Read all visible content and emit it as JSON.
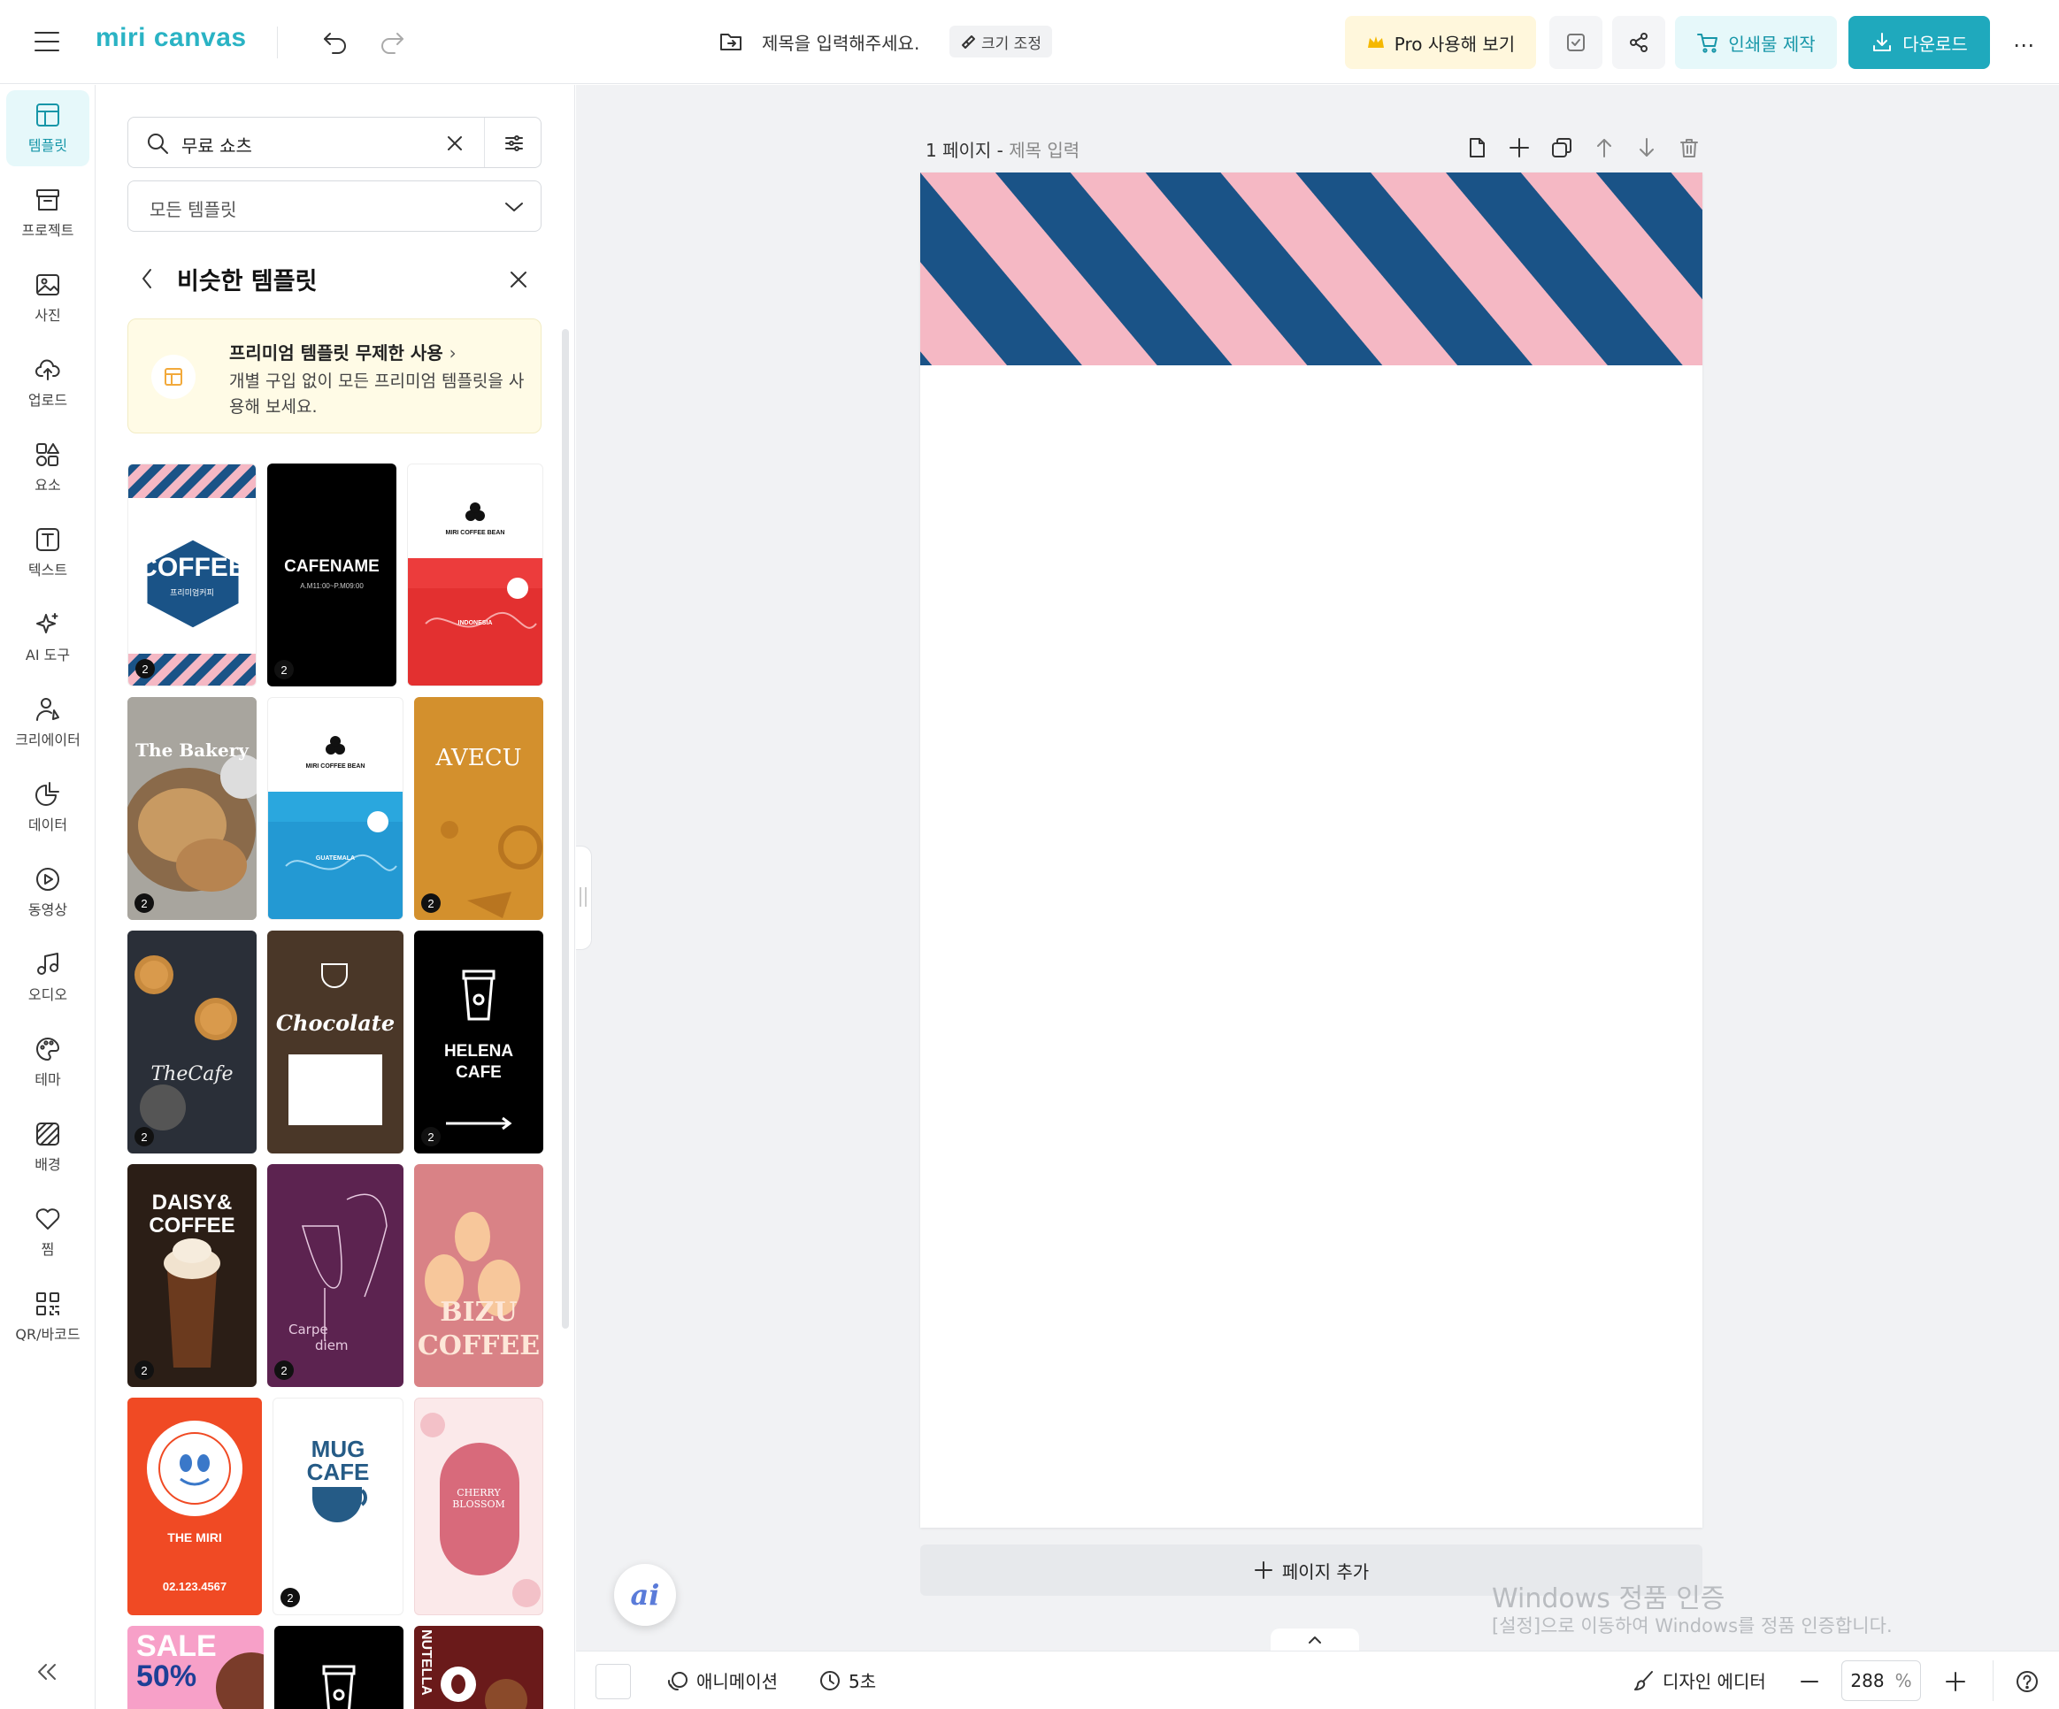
{
  "app": {
    "logo_text": "miri canvas",
    "doc_title_placeholder": "제목을 입력해주세요.",
    "resize_label": "크기 조정",
    "pro_label": "Pro 사용해 보기",
    "print_label": "인쇄물 제작",
    "download_label": "다운로드"
  },
  "nav": {
    "items": [
      {
        "label": "템플릿",
        "icon": "template-icon"
      },
      {
        "label": "프로젝트",
        "icon": "project-icon"
      },
      {
        "label": "사진",
        "icon": "photo-icon"
      },
      {
        "label": "업로드",
        "icon": "upload-icon"
      },
      {
        "label": "요소",
        "icon": "elements-icon"
      },
      {
        "label": "텍스트",
        "icon": "text-icon"
      },
      {
        "label": "AI 도구",
        "icon": "ai-tools-icon"
      },
      {
        "label": "크리에이터",
        "icon": "creator-icon"
      },
      {
        "label": "데이터",
        "icon": "data-icon"
      },
      {
        "label": "동영상",
        "icon": "video-icon"
      },
      {
        "label": "오디오",
        "icon": "audio-icon"
      },
      {
        "label": "테마",
        "icon": "theme-icon"
      },
      {
        "label": "배경",
        "icon": "background-icon"
      },
      {
        "label": "찜",
        "icon": "heart-icon"
      },
      {
        "label": "QR/바코드",
        "icon": "qr-icon"
      }
    ]
  },
  "panel": {
    "search_value": "무료 쇼츠",
    "category_selected": "모든 템플릿",
    "similar_title": "비슷한 템플릿",
    "promo_title": "프리미엄 템플릿 무제한 사용",
    "promo_desc": "개별 구입 없이 모든 프리미엄 템플릿을 사용해 보세요.",
    "templates": {
      "coffee": {
        "title": "COFFEE",
        "sub": "프리미엄커피",
        "badge": "2"
      },
      "cafename": {
        "title": "CAFENAME",
        "sub": "A.M11:00~P.M09:00",
        "badge": "2"
      },
      "bean_red": {
        "title": "MIRI COFFEE BEAN",
        "country": "INDONESIA"
      },
      "bakery": {
        "title": "The Bakery",
        "badge": "2"
      },
      "bean_blue": {
        "title": "MIRI COFFEE BEAN",
        "country": "GUATEMALA"
      },
      "avecu": {
        "title": "AVECU",
        "badge": "2"
      },
      "thecafe": {
        "title": "TheCafe",
        "badge": "2"
      },
      "chocolate": {
        "title": "Chocolate"
      },
      "helena": {
        "title1": "HELENA",
        "title2": "CAFE",
        "badge": "2"
      },
      "daisy": {
        "title1": "DAISY&",
        "title2": "COFFEE",
        "badge": "2"
      },
      "carpe": {
        "title1": "Carpe",
        "title2": "diem",
        "badge": "2"
      },
      "bizu": {
        "title1": "BIZU",
        "title2": "COFFEE"
      },
      "smoothie": {
        "title": "THE MIRI",
        "phone": "02.123.4567"
      },
      "mugcafe": {
        "title1": "MUG",
        "title2": "CAFE",
        "badge": "2"
      },
      "cherry": {
        "title": "CHERRY BLOSSOM"
      },
      "sale": {
        "title1": "SALE",
        "title2": "50%"
      },
      "nutella": {
        "title": "NUTELLA"
      }
    }
  },
  "workspace": {
    "page_number": "1 페이지",
    "separator": " - ",
    "page_title_placeholder": "제목 입력",
    "add_page_label": "페이지 추가",
    "watermark_title": "Windows 정품 인증",
    "watermark_desc": "[설정]으로 이동하여 Windows를 정품 인증합니다."
  },
  "bottom": {
    "animation_label": "애니메이션",
    "duration_label": "5초",
    "design_editor_label": "디자인 에디터",
    "zoom_value": "288",
    "zoom_unit": "%"
  },
  "colors": {
    "accent": "#1fa9bd",
    "stripe_pink": "#f5b8c4",
    "stripe_navy": "#1a5387"
  }
}
